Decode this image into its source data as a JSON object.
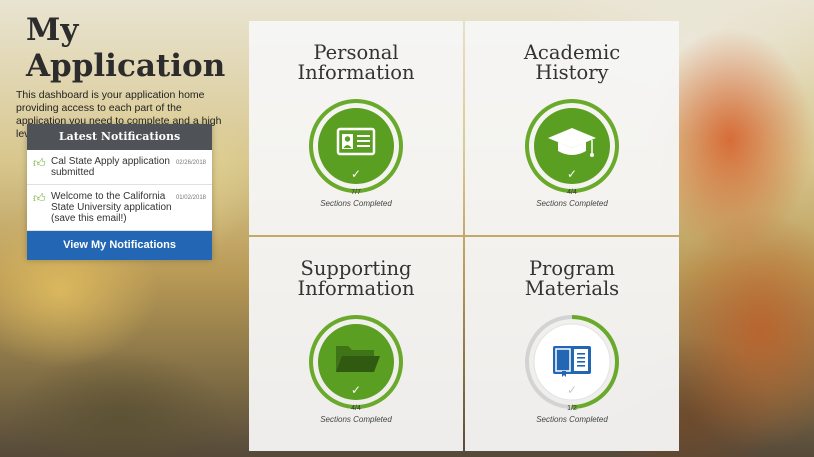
{
  "header": {
    "title": "My Application",
    "description": "This dashboard is your application home providing access to each part of the application you need to complete and a high level overview of your progress."
  },
  "notifications": {
    "title": "Latest Notifications",
    "items": [
      {
        "text": "Cal State Apply application submitted",
        "date": "02/26/2018"
      },
      {
        "text": "Welcome to the California State University application (save this email!)",
        "date": "01/02/2018"
      }
    ],
    "button_label": "View My Notifications"
  },
  "tiles": [
    {
      "title_line1": "Personal",
      "title_line2": "Information",
      "completed": 7,
      "total": 7,
      "count_label": "7/7",
      "status_label": "Sections Completed",
      "icon": "id-card-icon"
    },
    {
      "title_line1": "Academic",
      "title_line2": "History",
      "completed": 4,
      "total": 4,
      "count_label": "4/4",
      "status_label": "Sections Completed",
      "icon": "graduation-cap-icon"
    },
    {
      "title_line1": "Supporting",
      "title_line2": "Information",
      "completed": 4,
      "total": 4,
      "count_label": "4/4",
      "status_label": "Sections Completed",
      "icon": "folder-icon"
    },
    {
      "title_line1": "Program",
      "title_line2": "Materials",
      "completed": 1,
      "total": 2,
      "count_label": "1/2",
      "status_label": "Sections Completed",
      "icon": "book-icon"
    }
  ],
  "colors": {
    "progress_green": "#6aaa2a",
    "icon_green": "#5a9e22",
    "track_grey": "#d3d3d3",
    "icon_blue": "#2266b4",
    "button_blue": "#2266b4",
    "notification_header": "#4f5256"
  }
}
